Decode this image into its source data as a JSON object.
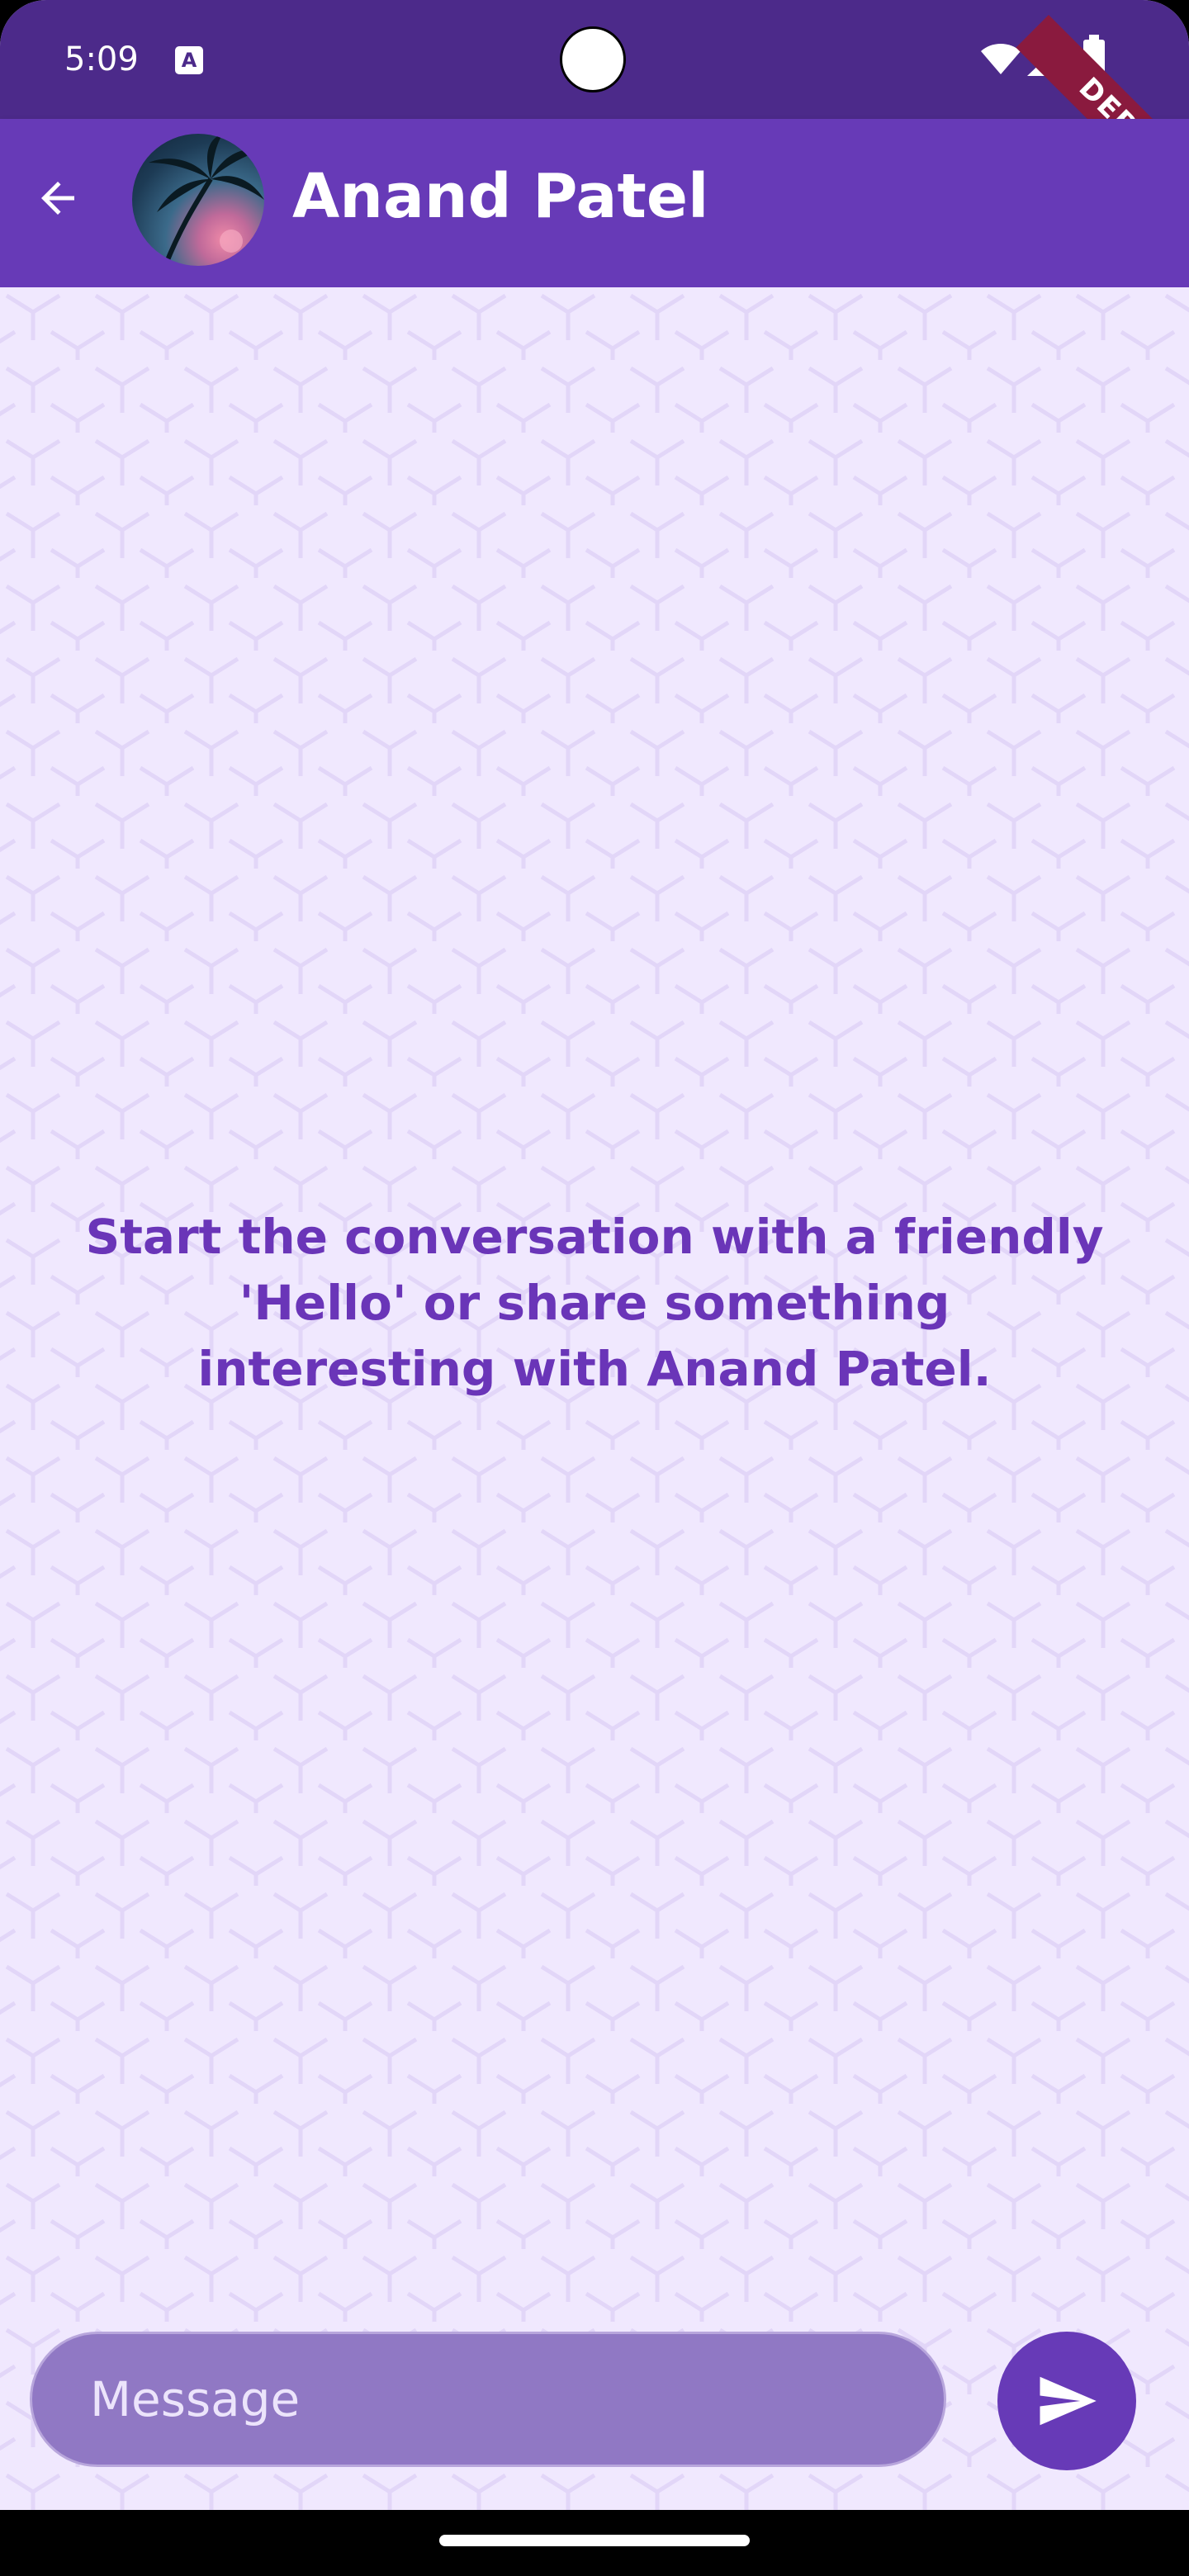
{
  "status_bar": {
    "time": "5:09",
    "icons": [
      "a-notification-icon",
      "wifi-icon",
      "signal-icon",
      "battery-icon"
    ],
    "debug_label": "DEBUG"
  },
  "app_bar": {
    "back_icon": "arrow-left-icon",
    "contact_name": "Anand Patel",
    "background_color": "#673ab7"
  },
  "chat": {
    "empty_state_text": "Start the conversation with a friendly 'Hello' or share something interesting with Anand Patel.",
    "text_color": "#6a35b8",
    "background_color": "#f0e8fe"
  },
  "composer": {
    "placeholder": "Message",
    "send_icon": "send-icon",
    "send_button_color": "#673ab7"
  }
}
